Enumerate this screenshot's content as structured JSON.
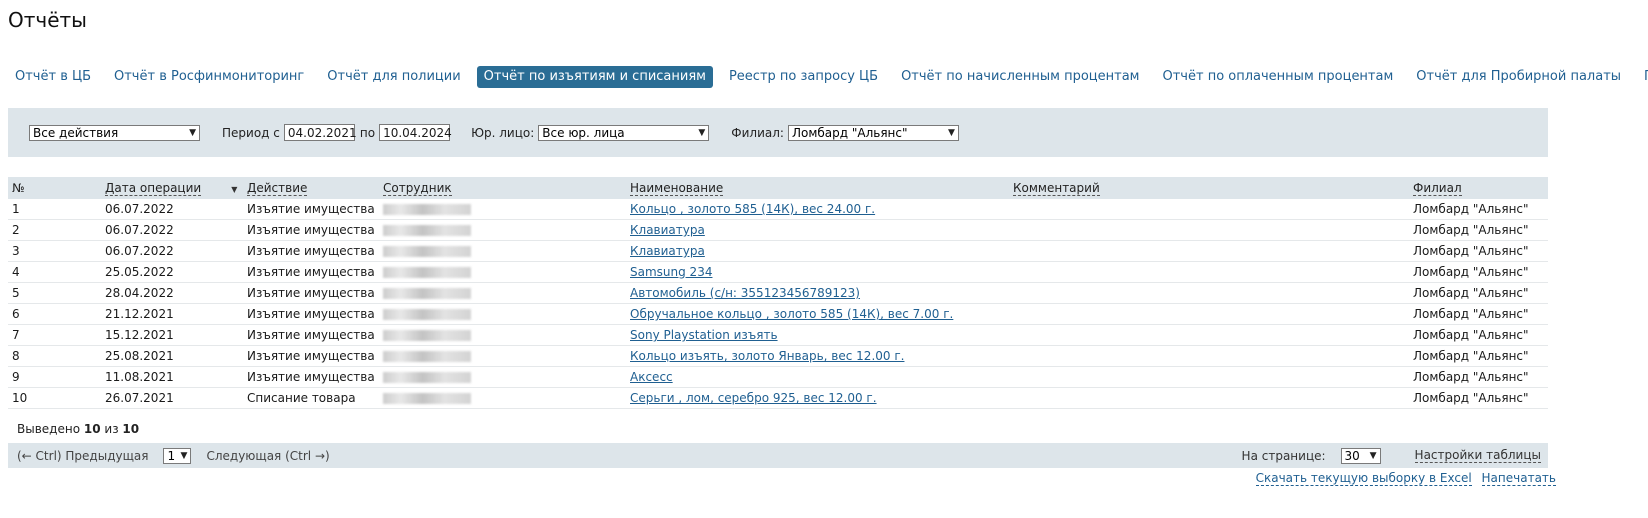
{
  "page_title": "Отчёты",
  "tabs": [
    {
      "label": "Отчёт в ЦБ",
      "active": false
    },
    {
      "label": "Отчёт в Росфинмониторинг",
      "active": false
    },
    {
      "label": "Отчёт для полиции",
      "active": false
    },
    {
      "label": "Отчёт по изъятиям и списаниям",
      "active": true
    },
    {
      "label": "Реестр по запросу ЦБ",
      "active": false
    },
    {
      "label": "Отчёт по начисленным процентам",
      "active": false
    },
    {
      "label": "Отчёт по оплаченным процентам",
      "active": false
    },
    {
      "label": "Отчёт для Пробирной палаты",
      "active": false
    },
    {
      "label": "ГИИС ДМДК",
      "active": false
    }
  ],
  "filters": {
    "action_select": "Все действия",
    "period_label": "Период с",
    "date_from": "04.02.2021",
    "to_label": "по",
    "date_to": "10.04.2024",
    "entity_label": "Юр. лицо:",
    "entity_select": "Все юр. лица",
    "branch_label": "Филиал:",
    "branch_select": "Ломбард \"Альянс\""
  },
  "table": {
    "columns": [
      "№",
      "Дата операции",
      "Действие",
      "Сотрудник",
      "Наименование",
      "Комментарий",
      "Филиал"
    ],
    "rows": [
      {
        "num": "1",
        "date": "06.07.2022",
        "action": "Изъятие имущества",
        "name": "Кольцо , золото 585 (14К), вес 24.00 г.",
        "comment": "",
        "branch": "Ломбард \"Альянс\""
      },
      {
        "num": "2",
        "date": "06.07.2022",
        "action": "Изъятие имущества",
        "name": "Клавиатура",
        "comment": "",
        "branch": "Ломбард \"Альянс\""
      },
      {
        "num": "3",
        "date": "06.07.2022",
        "action": "Изъятие имущества",
        "name": "Клавиатура",
        "comment": "",
        "branch": "Ломбард \"Альянс\""
      },
      {
        "num": "4",
        "date": "25.05.2022",
        "action": "Изъятие имущества",
        "name": "Samsung 234",
        "comment": "",
        "branch": "Ломбард \"Альянс\""
      },
      {
        "num": "5",
        "date": "28.04.2022",
        "action": "Изъятие имущества",
        "name": "Автомобиль (с/н: 355123456789123)",
        "comment": "",
        "branch": "Ломбард \"Альянс\""
      },
      {
        "num": "6",
        "date": "21.12.2021",
        "action": "Изъятие имущества",
        "name": "Обручальное кольцо , золото 585 (14К), вес 7.00 г.",
        "comment": "",
        "branch": "Ломбард \"Альянс\""
      },
      {
        "num": "7",
        "date": "15.12.2021",
        "action": "Изъятие имущества",
        "name": "Sony Playstation изъять",
        "comment": "",
        "branch": "Ломбард \"Альянс\""
      },
      {
        "num": "8",
        "date": "25.08.2021",
        "action": "Изъятие имущества",
        "name": "Кольцо изъять, золото Январь, вес 12.00 г.",
        "comment": "",
        "branch": "Ломбард \"Альянс\""
      },
      {
        "num": "9",
        "date": "11.08.2021",
        "action": "Изъятие имущества",
        "name": "Аксесс",
        "comment": "",
        "branch": "Ломбард \"Альянс\""
      },
      {
        "num": "10",
        "date": "26.07.2021",
        "action": "Списание товара",
        "name": "Серьги , лом, серебро 925, вес 12.00 г.",
        "comment": "",
        "branch": "Ломбард \"Альянс\""
      }
    ]
  },
  "summary": {
    "prefix": "Выведено",
    "shown": "10",
    "of": "из",
    "total": "10"
  },
  "pager": {
    "prev_label": "(← Ctrl) Предыдущая",
    "page_select": "1",
    "next_label": "Следующая (Ctrl →)",
    "per_page_label": "На странице:",
    "per_page_select": "30",
    "settings_label": "Настройки таблицы"
  },
  "bottom_links": {
    "excel": "Скачать текущую выборку в Excel",
    "print": "Напечатать"
  },
  "colors": {
    "accent": "#2a6d95",
    "link": "#1f5f91",
    "panel": "#dde5ea"
  }
}
